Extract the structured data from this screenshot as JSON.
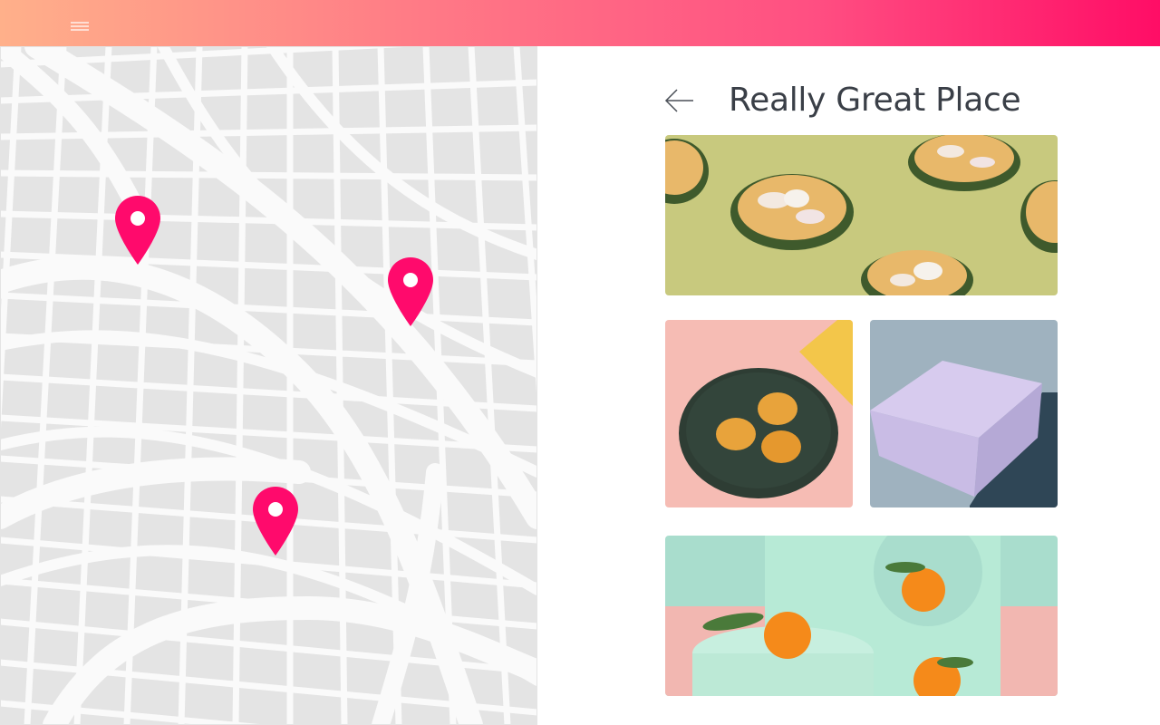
{
  "header": {
    "menu_icon": "hamburger-menu-icon"
  },
  "map": {
    "pin_icon": "map-pin-icon",
    "pin_color": "#ff0a6c",
    "pin_count": 3
  },
  "place": {
    "title": "Really Great Place",
    "back_icon": "arrow-left-icon"
  },
  "gallery": [
    {
      "name": "egg-tarts-on-green-photo"
    },
    {
      "name": "tarts-on-dark-plate-photo"
    },
    {
      "name": "lilac-box-photo"
    },
    {
      "name": "mandarins-on-mint-photo"
    }
  ],
  "colors": {
    "accent": "#ff0a6c",
    "gradient_start": "#ffb08a",
    "gradient_end": "#ff0d66"
  }
}
